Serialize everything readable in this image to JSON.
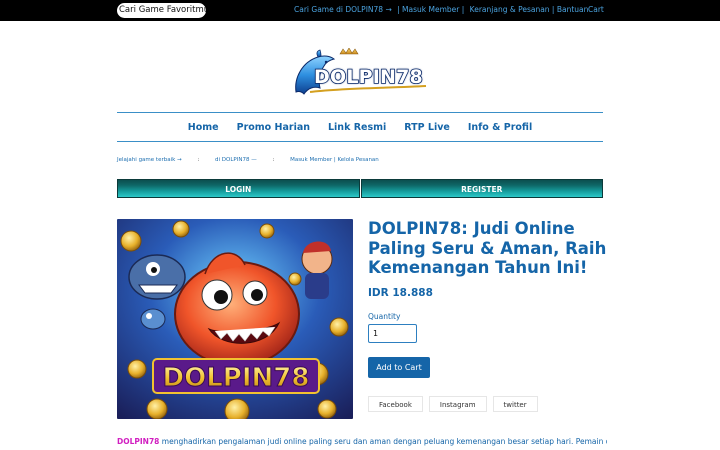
{
  "topbar": {
    "search_placeholder": "Cari Game Favoritmu",
    "links": [
      "Cari Game di DOLPIN78 →",
      "| Masuk Member |",
      "Keranjang & Pesanan | Bantuan"
    ],
    "cart": "Cart"
  },
  "brand": {
    "logo_text": "DOLPIN78"
  },
  "nav": {
    "items": [
      "Home",
      "Promo Harian",
      "Link Resmi",
      "RTP Live",
      "Info & Profil"
    ]
  },
  "breadcrumb": {
    "items": [
      "Jelajahi game terbaik →",
      ":",
      "di DOLPIN78 —",
      ":",
      "Masuk Member | Kelola Pesanan"
    ]
  },
  "auth": {
    "login": "LOGIN",
    "register": "REGISTER"
  },
  "hero": {
    "banner_text": "DOLPIN78"
  },
  "product": {
    "title": "DOLPIN78: Judi Online Paling Seru & Aman, Raih Kemenangan Tahun Ini!",
    "price": "IDR 18.888",
    "quantity_label": "Quantity",
    "quantity_value": "1",
    "add_to_cart": "Add to Cart"
  },
  "share": {
    "items": [
      "Facebook",
      "Instagram",
      "twitter"
    ]
  },
  "description": {
    "brand": "DOLPIN78",
    "text": " menghadirkan pengalaman judi online paling seru dan aman dengan peluang kemenangan besar setiap hari. Pemain dapat"
  },
  "colors": {
    "accent": "#1565a8",
    "topbar": "#000000",
    "auth_bar": "#0e6666",
    "brand_highlight": "#d11ec0"
  }
}
